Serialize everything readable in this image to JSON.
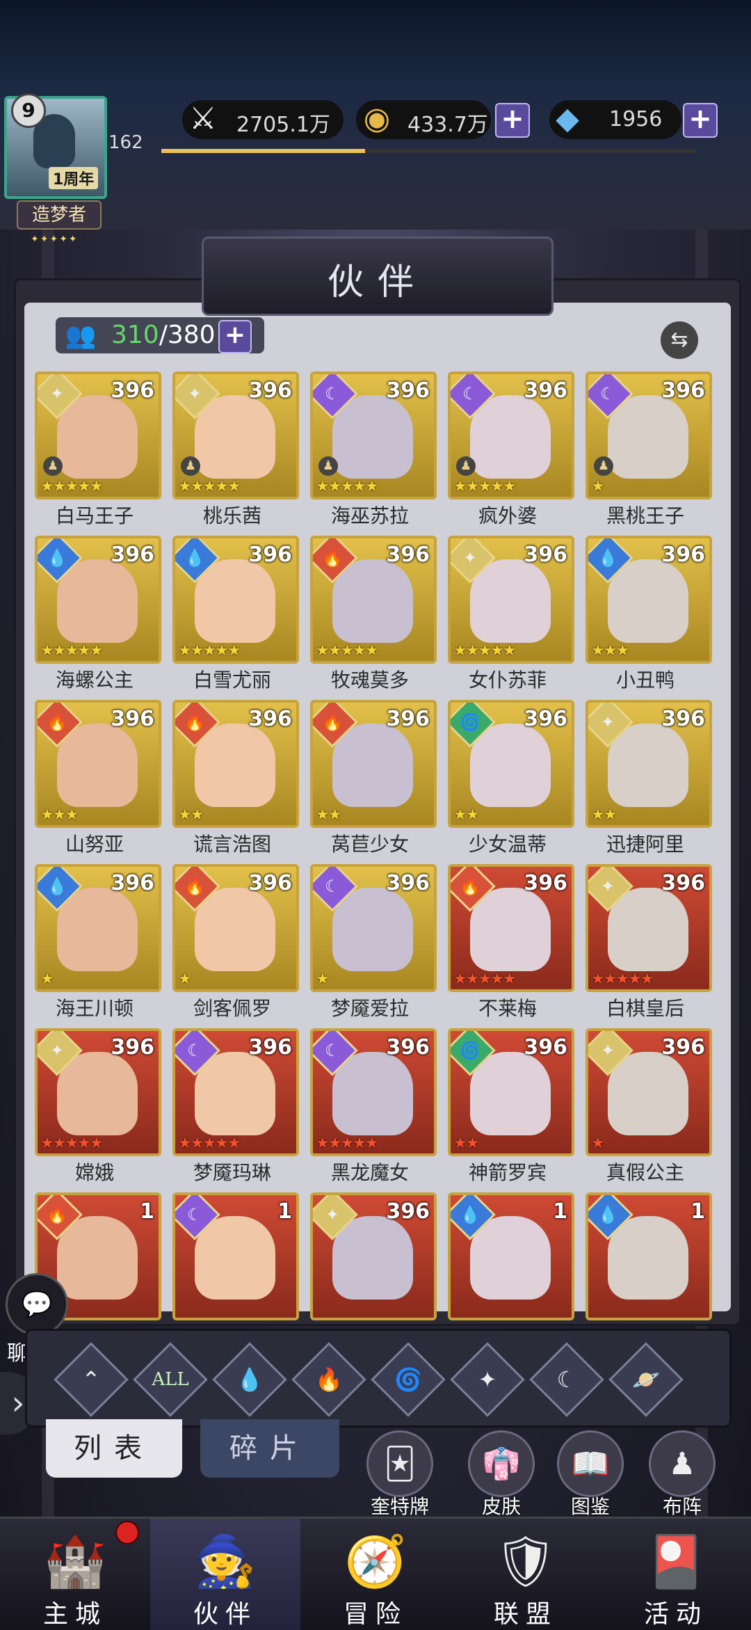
{
  "player": {
    "level": "9",
    "exp": "162",
    "exp_progress": 0.38,
    "title": "造梦者",
    "title_stars": "✦✦✦✦✦",
    "avatar_tag": "1周年"
  },
  "resources": {
    "power": "2705.1万",
    "gold": "433.7万",
    "gems": "1956",
    "plus": "+"
  },
  "header": {
    "title": "伙伴"
  },
  "roster": {
    "current": "310",
    "max": "/380",
    "plus": "+",
    "swap": "⇆"
  },
  "heroes": [
    {
      "name": "白马王子",
      "level": "396",
      "element": "light",
      "stars": 5,
      "star_color": "y",
      "frame": "gold",
      "pawn": true
    },
    {
      "name": "桃乐茜",
      "level": "396",
      "element": "light",
      "stars": 5,
      "star_color": "y",
      "frame": "gold",
      "pawn": true
    },
    {
      "name": "海巫苏拉",
      "level": "396",
      "element": "dark",
      "stars": 5,
      "star_color": "y",
      "frame": "gold",
      "pawn": true
    },
    {
      "name": "疯外婆",
      "level": "396",
      "element": "dark",
      "stars": 5,
      "star_color": "y",
      "frame": "gold",
      "pawn": true
    },
    {
      "name": "黑桃王子",
      "level": "396",
      "element": "dark",
      "stars": 1,
      "star_color": "y",
      "frame": "gold",
      "pawn": true
    },
    {
      "name": "海螺公主",
      "level": "396",
      "element": "water",
      "stars": 5,
      "star_color": "y",
      "frame": "gold",
      "pawn": false
    },
    {
      "name": "白雪尤丽",
      "level": "396",
      "element": "water",
      "stars": 5,
      "star_color": "y",
      "frame": "gold",
      "pawn": false
    },
    {
      "name": "牧魂莫多",
      "level": "396",
      "element": "fire",
      "stars": 5,
      "star_color": "y",
      "frame": "gold",
      "pawn": false
    },
    {
      "name": "女仆苏菲",
      "level": "396",
      "element": "light",
      "stars": 5,
      "star_color": "y",
      "frame": "gold",
      "pawn": false
    },
    {
      "name": "小丑鸭",
      "level": "396",
      "element": "water",
      "stars": 3,
      "star_color": "y",
      "frame": "gold",
      "pawn": false
    },
    {
      "name": "山努亚",
      "level": "396",
      "element": "fire",
      "stars": 3,
      "star_color": "y",
      "frame": "gold",
      "pawn": false
    },
    {
      "name": "谎言浩图",
      "level": "396",
      "element": "fire",
      "stars": 2,
      "star_color": "y",
      "frame": "gold",
      "pawn": false
    },
    {
      "name": "莴苣少女",
      "level": "396",
      "element": "fire",
      "stars": 2,
      "star_color": "y",
      "frame": "gold",
      "pawn": false
    },
    {
      "name": "少女温蒂",
      "level": "396",
      "element": "wind",
      "stars": 2,
      "star_color": "y",
      "frame": "gold",
      "pawn": false
    },
    {
      "name": "迅捷阿里",
      "level": "396",
      "element": "light",
      "stars": 2,
      "star_color": "y",
      "frame": "gold",
      "pawn": false
    },
    {
      "name": "海王川顿",
      "level": "396",
      "element": "water",
      "stars": 1,
      "star_color": "y",
      "frame": "gold",
      "pawn": false
    },
    {
      "name": "剑客佩罗",
      "level": "396",
      "element": "fire",
      "stars": 1,
      "star_color": "y",
      "frame": "gold",
      "pawn": false
    },
    {
      "name": "梦魇爱拉",
      "level": "396",
      "element": "dark",
      "stars": 1,
      "star_color": "y",
      "frame": "gold",
      "pawn": false
    },
    {
      "name": "不莱梅",
      "level": "396",
      "element": "fire",
      "stars": 5,
      "star_color": "r",
      "frame": "red",
      "pawn": false
    },
    {
      "name": "白棋皇后",
      "level": "396",
      "element": "light",
      "stars": 5,
      "star_color": "r",
      "frame": "red",
      "pawn": false
    },
    {
      "name": "嫦娥",
      "level": "396",
      "element": "light",
      "stars": 5,
      "star_color": "r",
      "frame": "red",
      "pawn": false
    },
    {
      "name": "梦魇玛琳",
      "level": "396",
      "element": "dark",
      "stars": 5,
      "star_color": "r",
      "frame": "red",
      "pawn": false
    },
    {
      "name": "黑龙魔女",
      "level": "396",
      "element": "dark",
      "stars": 5,
      "star_color": "r",
      "frame": "red",
      "pawn": false
    },
    {
      "name": "神箭罗宾",
      "level": "396",
      "element": "wind",
      "stars": 2,
      "star_color": "r",
      "frame": "red",
      "pawn": false
    },
    {
      "name": "真假公主",
      "level": "396",
      "element": "light",
      "stars": 1,
      "star_color": "r",
      "frame": "red",
      "pawn": false
    },
    {
      "name": "",
      "level": "1",
      "element": "fire",
      "stars": 0,
      "star_color": "r",
      "frame": "red",
      "pawn": false
    },
    {
      "name": "",
      "level": "1",
      "element": "dark",
      "stars": 0,
      "star_color": "r",
      "frame": "red",
      "pawn": false
    },
    {
      "name": "",
      "level": "396",
      "element": "light",
      "stars": 0,
      "star_color": "r",
      "frame": "red",
      "pawn": false
    },
    {
      "name": "",
      "level": "1",
      "element": "water",
      "stars": 0,
      "star_color": "r",
      "frame": "red",
      "pawn": false
    },
    {
      "name": "",
      "level": "1",
      "element": "water",
      "stars": 0,
      "star_color": "r",
      "frame": "red",
      "pawn": false
    }
  ],
  "element_glyphs": {
    "light": "✦",
    "dark": "☾",
    "water": "💧",
    "fire": "🔥",
    "wind": "🌀"
  },
  "element_colors": {
    "light": "#d8c26a",
    "dark": "#8a5ad8",
    "water": "#3a7ad8",
    "fire": "#d8523a",
    "wind": "#3aaa6a"
  },
  "filters": [
    {
      "id": "favorite",
      "glyph": "⌃"
    },
    {
      "id": "all",
      "glyph": "ALL"
    },
    {
      "id": "water",
      "glyph": "💧"
    },
    {
      "id": "fire",
      "glyph": "🔥"
    },
    {
      "id": "wind",
      "glyph": "🌀"
    },
    {
      "id": "light",
      "glyph": "✦"
    },
    {
      "id": "dark",
      "glyph": "☾"
    },
    {
      "id": "cosmic",
      "glyph": "🪐"
    }
  ],
  "tabs": {
    "list": "列表",
    "fragments": "碎片"
  },
  "side_buttons": [
    {
      "label": "奎特牌",
      "icon": "🃏"
    },
    {
      "label": "皮肤",
      "icon": "👘"
    },
    {
      "label": "图鉴",
      "icon": "📖"
    },
    {
      "label": "布阵",
      "icon": "♟"
    }
  ],
  "chat": {
    "label": "聊天",
    "icon": "💬"
  },
  "side_arrow": "›",
  "nav": [
    {
      "label": "主城",
      "icon": "🏰"
    },
    {
      "label": "伙伴",
      "icon": "🧙"
    },
    {
      "label": "冒险",
      "icon": "🧭"
    },
    {
      "label": "联盟",
      "icon": "🛡"
    },
    {
      "label": "活动",
      "icon": "🎴"
    }
  ]
}
